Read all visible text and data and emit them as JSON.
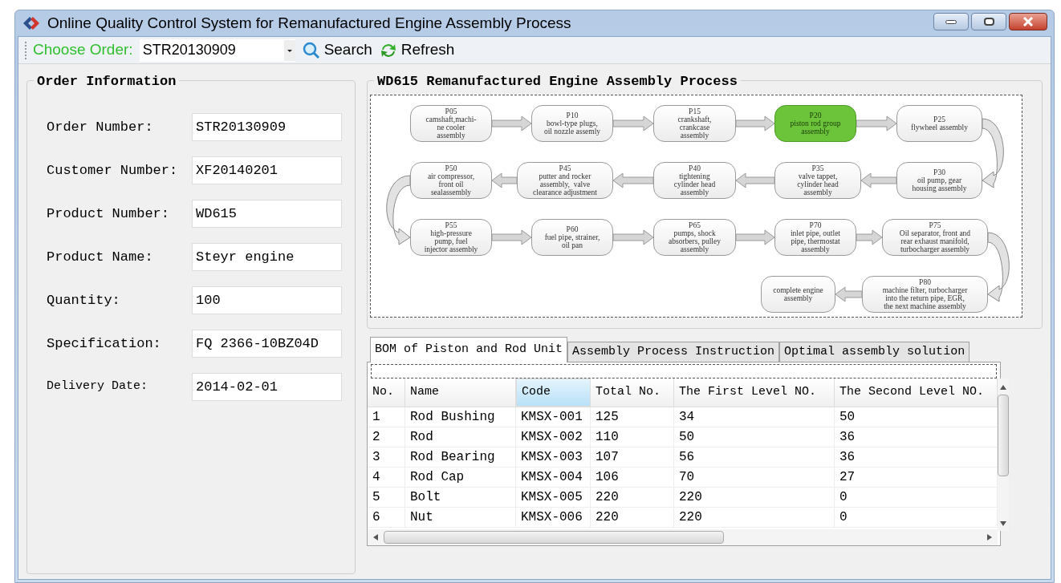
{
  "window": {
    "title": "Online Quality Control System for Remanufactured Engine Assembly Process"
  },
  "toolbar": {
    "order_label": "Choose Order:",
    "order_value": "STR20130909",
    "search": "Search",
    "refresh": "Refresh"
  },
  "order_info": {
    "title": "Order Information",
    "fields": [
      {
        "label": "Order Number:",
        "value": "STR20130909"
      },
      {
        "label": "Customer Number:",
        "value": "XF20140201"
      },
      {
        "label": "Product Number:",
        "value": "WD615"
      },
      {
        "label": "Product Name:",
        "value": "Steyr engine"
      },
      {
        "label": "Quantity:",
        "value": "100"
      },
      {
        "label": "Specification:",
        "value": "FQ 2366-10BZ04D"
      },
      {
        "label": "Delivery Date:",
        "value": "2014-02-01"
      }
    ]
  },
  "process": {
    "title": "WD615 Remanufactured Engine Assembly Process",
    "steps": [
      {
        "code": "P05",
        "lines": [
          "camshaft,machi-",
          "ne cooler",
          "assembly"
        ],
        "selected": false
      },
      {
        "code": "P10",
        "lines": [
          "bowl-type plugs,",
          "oil nozzle assemly"
        ],
        "selected": false
      },
      {
        "code": "P15",
        "lines": [
          "crankshaft,",
          "crankcase",
          "assembly"
        ],
        "selected": false
      },
      {
        "code": "P20",
        "lines": [
          "piston rod group",
          "assembly"
        ],
        "selected": true
      },
      {
        "code": "P25",
        "lines": [
          "flywheel assembly"
        ],
        "selected": false
      },
      {
        "code": "P50",
        "lines": [
          "air compressor,",
          "front oil",
          "sealassembly"
        ],
        "selected": false
      },
      {
        "code": "P45",
        "lines": [
          "putter and rocker",
          "assembly,  valve",
          "clearance adjustment"
        ],
        "selected": false
      },
      {
        "code": "P40",
        "lines": [
          "tightening",
          "cylinder head",
          "assembly"
        ],
        "selected": false
      },
      {
        "code": "P35",
        "lines": [
          "valve tappet,",
          "cylinder head",
          "assembly"
        ],
        "selected": false
      },
      {
        "code": "P30",
        "lines": [
          "oil pump, gear",
          "housing assembly"
        ],
        "selected": false
      },
      {
        "code": "P55",
        "lines": [
          "high-pressure",
          "pump, fuel",
          "injector assembly"
        ],
        "selected": false
      },
      {
        "code": "P60",
        "lines": [
          "fuel pipe, strainer,",
          "oil pan"
        ],
        "selected": false
      },
      {
        "code": "P65",
        "lines": [
          "pumps, shock",
          "absorbers, pulley",
          "assembly"
        ],
        "selected": false
      },
      {
        "code": "P70",
        "lines": [
          "inlet pipe, outlet",
          "pipe, thermostat",
          "assembly"
        ],
        "selected": false
      },
      {
        "code": "P75",
        "lines": [
          "Oil separator, front and",
          "rear exhaust manifold,",
          "turbocharger assembly"
        ],
        "selected": false
      },
      {
        "lines": [
          "complete engine",
          "assembly"
        ],
        "selected": false
      },
      {
        "code": "P80",
        "lines": [
          "machine filter, turbocharger",
          "into the return pipe, EGR,",
          "the next machine assembly"
        ],
        "selected": false
      }
    ]
  },
  "tabs": [
    {
      "label": "BOM of Piston and Rod Unit",
      "selected": true
    },
    {
      "label": "Assembly Process Instruction",
      "selected": false
    },
    {
      "label": "Optimal assembly solution",
      "selected": false
    }
  ],
  "table": {
    "columns": [
      {
        "label": "No.",
        "selected": false
      },
      {
        "label": "Name",
        "selected": false
      },
      {
        "label": "Code",
        "selected": true
      },
      {
        "label": "Total No.",
        "selected": false
      },
      {
        "label": "The First Level NO.",
        "selected": false
      },
      {
        "label": "The Second Level NO.",
        "selected": false
      }
    ],
    "rows": [
      [
        "1",
        "Rod Bushing",
        "KMSX-001",
        "125",
        "34",
        "50"
      ],
      [
        "2",
        "Rod",
        "KMSX-002",
        "110",
        "50",
        "36"
      ],
      [
        "3",
        "Rod Bearing",
        "KMSX-003",
        "107",
        "56",
        "36"
      ],
      [
        "4",
        "Rod Cap",
        "KMSX-004",
        "106",
        "70",
        "27"
      ],
      [
        "5",
        "Bolt",
        "KMSX-005",
        "220",
        "220",
        "0"
      ],
      [
        "6",
        "Nut",
        "KMSX-006",
        "220",
        "220",
        "0"
      ]
    ]
  }
}
